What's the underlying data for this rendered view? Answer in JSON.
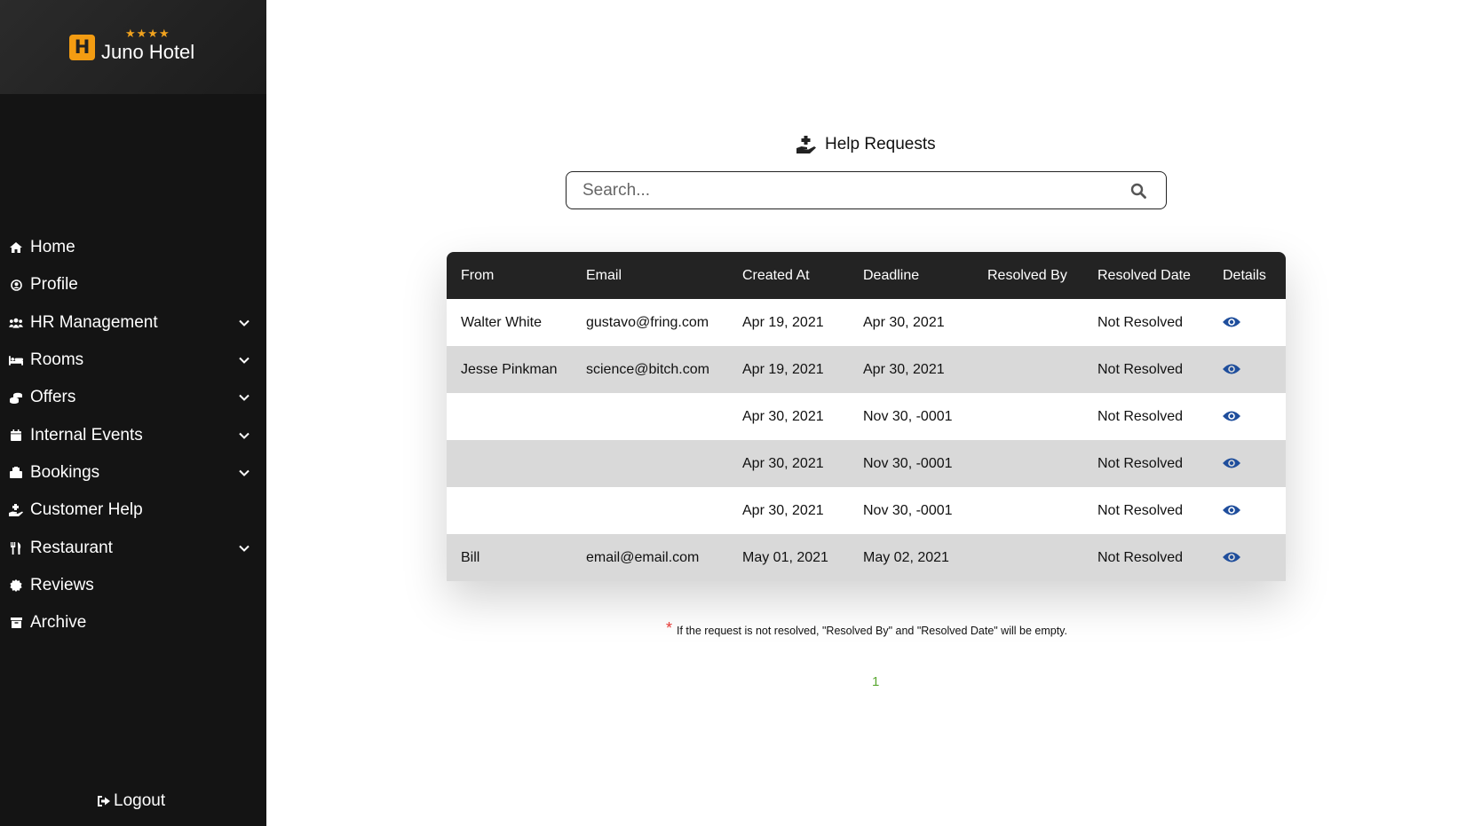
{
  "brand": {
    "name": "Juno Hotel",
    "logo_letter": "H",
    "stars": "★★★★"
  },
  "sidebar": {
    "items": [
      {
        "label": "Home",
        "icon": "home-icon",
        "has_chevron": false
      },
      {
        "label": "Profile",
        "icon": "user-circle-icon",
        "has_chevron": false
      },
      {
        "label": "HR Management",
        "icon": "users-icon",
        "has_chevron": true
      },
      {
        "label": "Rooms",
        "icon": "bed-icon",
        "has_chevron": true
      },
      {
        "label": "Offers",
        "icon": "coins-icon",
        "has_chevron": true
      },
      {
        "label": "Internal Events",
        "icon": "calendar-icon",
        "has_chevron": true
      },
      {
        "label": "Bookings",
        "icon": "book-icon",
        "has_chevron": true
      },
      {
        "label": "Customer Help",
        "icon": "hand-holding-icon",
        "has_chevron": false
      },
      {
        "label": "Restaurant",
        "icon": "utensils-icon",
        "has_chevron": true
      },
      {
        "label": "Reviews",
        "icon": "certificate-icon",
        "has_chevron": false
      },
      {
        "label": "Archive",
        "icon": "archive-icon",
        "has_chevron": false
      }
    ],
    "logout_label": "Logout"
  },
  "page": {
    "title": "Help Requests",
    "search_placeholder": "Search..."
  },
  "table": {
    "headers": [
      "From",
      "Email",
      "Created At",
      "Deadline",
      "Resolved By",
      "Resolved Date",
      "Details"
    ],
    "rows": [
      {
        "from": "Walter White",
        "email": "gustavo@fring.com",
        "created_at": "Apr 19, 2021",
        "deadline": "Apr 30, 2021",
        "resolved_by": "",
        "resolved_date": "Not Resolved"
      },
      {
        "from": "Jesse Pinkman",
        "email": "science@bitch.com",
        "created_at": "Apr 19, 2021",
        "deadline": "Apr 30, 2021",
        "resolved_by": "",
        "resolved_date": "Not Resolved"
      },
      {
        "from": "",
        "email": "",
        "created_at": "Apr 30, 2021",
        "deadline": "Nov 30, -0001",
        "resolved_by": "",
        "resolved_date": "Not Resolved"
      },
      {
        "from": "",
        "email": "",
        "created_at": "Apr 30, 2021",
        "deadline": "Nov 30, -0001",
        "resolved_by": "",
        "resolved_date": "Not Resolved"
      },
      {
        "from": "",
        "email": "",
        "created_at": "Apr 30, 2021",
        "deadline": "Nov 30, -0001",
        "resolved_by": "",
        "resolved_date": "Not Resolved"
      },
      {
        "from": "Bill",
        "email": "email@email.com",
        "created_at": "May 01, 2021",
        "deadline": "May 02, 2021",
        "resolved_by": "",
        "resolved_date": "Not Resolved"
      }
    ]
  },
  "note": {
    "asterisk": "*",
    "text": "If the request is not resolved, \"Resolved By\" and \"Resolved Date\" will be empty."
  },
  "pagination": {
    "current_page": "1"
  },
  "colors": {
    "accent": "#f39c12",
    "sidebar_bg": "#141414",
    "table_header_bg": "#232323",
    "eye_icon": "#1f4e9c",
    "pager": "#5aa832"
  }
}
